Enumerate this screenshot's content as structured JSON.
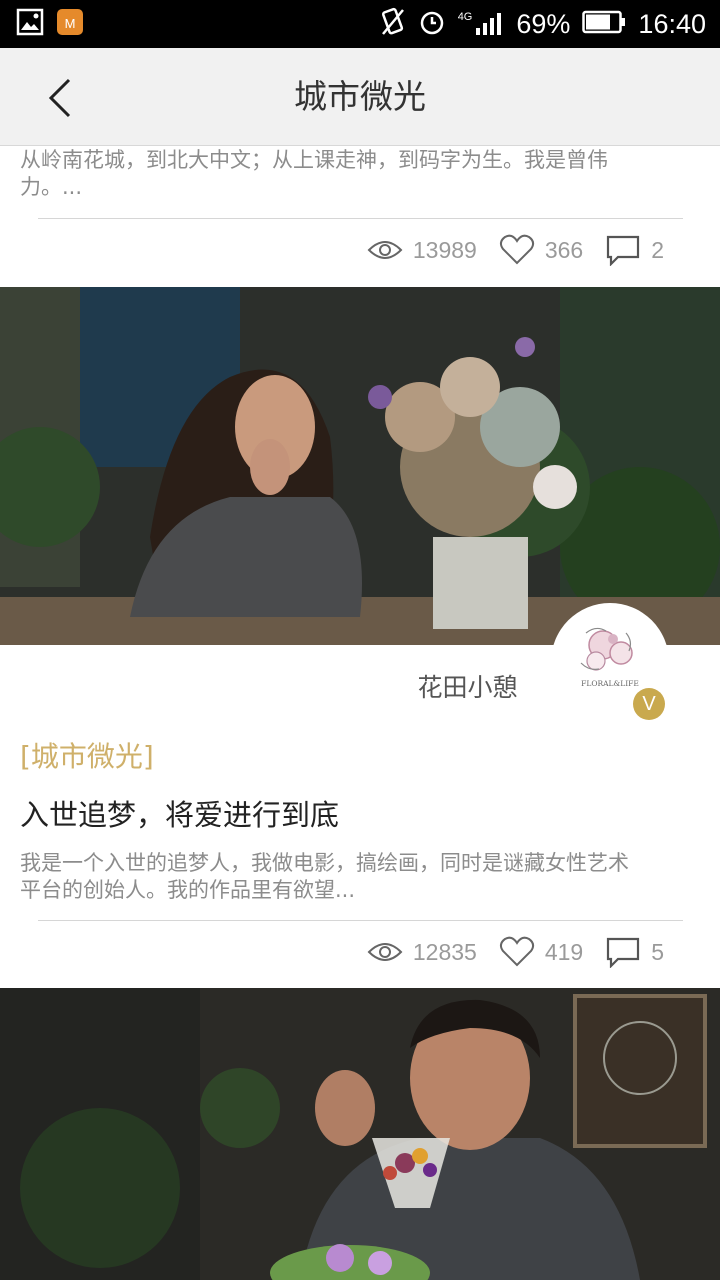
{
  "status_bar": {
    "battery": "69%",
    "time": "16:40",
    "network": "4G",
    "icons": [
      "gallery-icon",
      "app-icon",
      "vibrate-icon",
      "alarm-icon",
      "signal-icon",
      "battery-icon"
    ]
  },
  "header": {
    "title": "城市微光",
    "back_icon": "chevron-left-icon"
  },
  "posts": [
    {
      "summary": "从岭南花城，到北大中文；从上课走神，到码字为生。我是曾伟力。...",
      "views": "13989",
      "likes": "366",
      "comments": "2"
    },
    {
      "author": "花田小憩",
      "avatar_caption": "FLORAL&LIFE",
      "verified": "V",
      "tag": "[城市微光]",
      "title": "入世追梦，将爱进行到底",
      "summary": "我是一个入世的追梦人，我做电影，搞绘画，同时是谜藏女性艺术平台的创始人。我的作品里有欲望...",
      "views": "12835",
      "likes": "419",
      "comments": "5"
    }
  ],
  "colors": {
    "status_bar": "#000000",
    "app_bar": "#f1f1f1",
    "tag": "#cfb06a",
    "verified_badge": "#c9a94e"
  }
}
